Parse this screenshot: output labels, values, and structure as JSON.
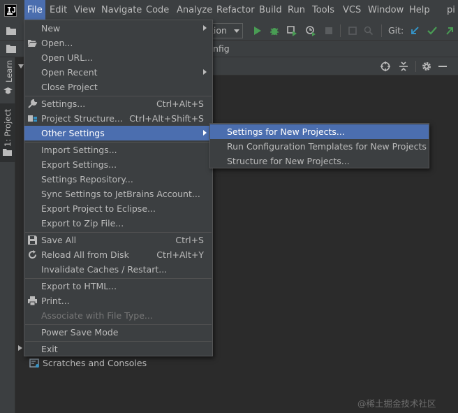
{
  "menubar": {
    "logo_text": "IJ",
    "items": [
      "File",
      "Edit",
      "View",
      "Navigate",
      "Code",
      "Analyze",
      "Refactor",
      "Build",
      "Run",
      "Tools",
      "VCS",
      "Window",
      "Help"
    ],
    "cut_text": "pi"
  },
  "toolbar": {
    "run_config_visible": "tion",
    "git_label": "Git:"
  },
  "navbar": {
    "text_visible": "nfig"
  },
  "left_strip": {
    "learn_tab": "Learn",
    "project_tab": "1: Project"
  },
  "file_menu": {
    "items": [
      {
        "label": "New",
        "shortcut": "",
        "submenu": true
      },
      {
        "label": "Open...",
        "shortcut": "",
        "icon": "folder-open-icon"
      },
      {
        "label": "Open URL...",
        "shortcut": ""
      },
      {
        "label": "Open Recent",
        "shortcut": "",
        "submenu": true
      },
      {
        "label": "Close Project",
        "shortcut": ""
      },
      {
        "label": "Settings...",
        "shortcut": "Ctrl+Alt+S",
        "icon": "wrench-icon"
      },
      {
        "label": "Project Structure...",
        "shortcut": "Ctrl+Alt+Shift+S",
        "icon": "project-structure-icon"
      },
      {
        "label": "Other Settings",
        "shortcut": "",
        "submenu": true,
        "selected": true
      },
      {
        "label": "Import Settings...",
        "shortcut": ""
      },
      {
        "label": "Export Settings...",
        "shortcut": ""
      },
      {
        "label": "Settings Repository...",
        "shortcut": ""
      },
      {
        "label": "Sync Settings to JetBrains Account...",
        "shortcut": ""
      },
      {
        "label": "Export Project to Eclipse...",
        "shortcut": ""
      },
      {
        "label": "Export to Zip File...",
        "shortcut": ""
      },
      {
        "label": "Save All",
        "shortcut": "Ctrl+S",
        "icon": "save-icon"
      },
      {
        "label": "Reload All from Disk",
        "shortcut": "Ctrl+Alt+Y",
        "icon": "reload-icon"
      },
      {
        "label": "Invalidate Caches / Restart...",
        "shortcut": ""
      },
      {
        "label": "Export to HTML...",
        "shortcut": ""
      },
      {
        "label": "Print...",
        "shortcut": "",
        "icon": "print-icon"
      },
      {
        "label": "Associate with File Type...",
        "shortcut": "",
        "disabled": true
      },
      {
        "label": "Power Save Mode",
        "shortcut": ""
      },
      {
        "label": "Exit",
        "shortcut": ""
      }
    ]
  },
  "other_settings_submenu": {
    "items": [
      {
        "label": "Settings for New Projects...",
        "selected": true
      },
      {
        "label": "Run Configuration Templates for New Projects"
      },
      {
        "label": "Structure for New Projects..."
      }
    ]
  },
  "project_tree": {
    "scratches_label": "Scratches and Consoles"
  },
  "watermark": "@稀土掘金技术社区",
  "colors": {
    "menu_bg": "#3c3f41",
    "selection": "#4b6eaf",
    "editor_bg": "#2b2b2b",
    "run_green": "#499c54",
    "git_blue": "#3592c4"
  }
}
